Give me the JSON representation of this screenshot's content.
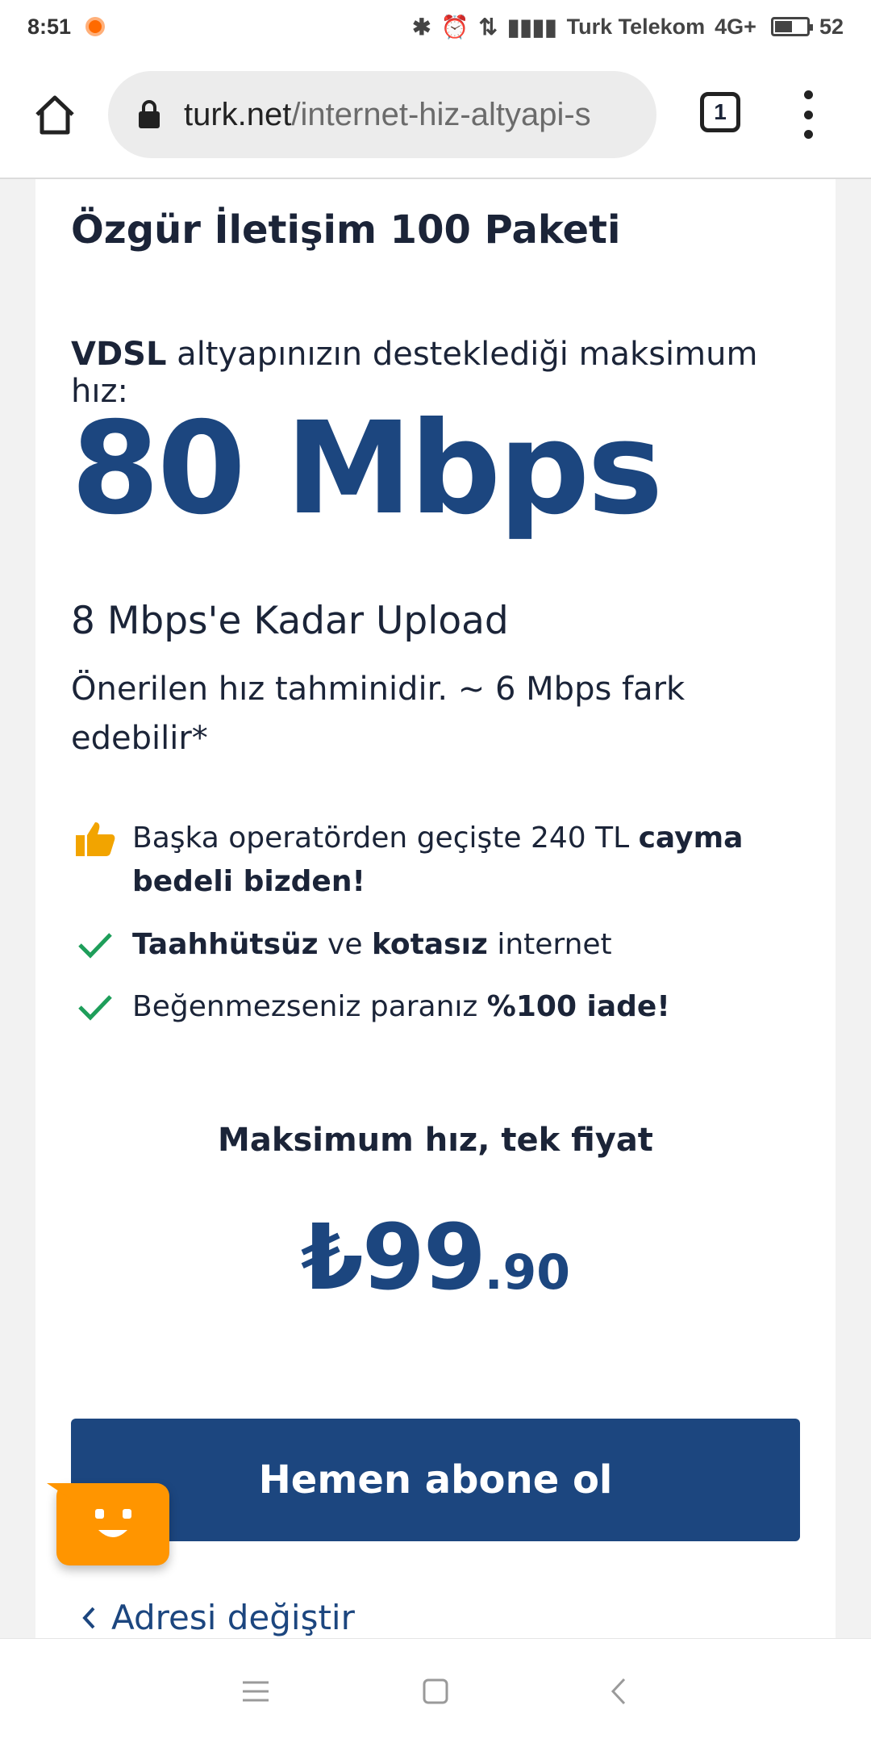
{
  "status_bar": {
    "time": "8:51",
    "carrier": "Turk Telekom",
    "network": "4G+",
    "battery": "52",
    "battery_level": 0.52,
    "icons": [
      "bluetooth-icon",
      "alarm-icon",
      "data-transfer-icon",
      "signal-icon",
      "battery-icon"
    ]
  },
  "browser": {
    "url_domain": "turk.net",
    "url_path": "/internet-hiz-altyapi-s",
    "tab_count": "1"
  },
  "package": {
    "title": "Özgür İletişim 100 Paketi",
    "infra_bold": "VDSL",
    "infra_text": " altyapınızın desteklediği maksimum hız:",
    "speed": "80 Mbps",
    "upload": "8 Mbps'e Kadar Upload",
    "note": "Önerilen hız tahminidir. ~ 6 Mbps fark edebilir*"
  },
  "features": [
    {
      "icon": "thumbs-up-icon",
      "text1": "Başka operatörden geçişte 240 TL ",
      "bold1": "cayma bedeli bizden!"
    },
    {
      "icon": "check-icon",
      "bold1": "Taahhütsüz",
      "text1": " ve ",
      "bold2": "kotasız",
      "text2": " internet"
    },
    {
      "icon": "check-icon",
      "text1": "Beğenmezseniz paranız ",
      "bold1": "%100 iade!"
    }
  ],
  "pricing": {
    "label": "Maksimum hız, tek fiyat",
    "currency": "₺",
    "amount": "99",
    "cents": ".90"
  },
  "actions": {
    "subscribe": "Hemen abone ol",
    "change_address": "Adresi değiştir"
  },
  "colors": {
    "brand_blue": "#1c467f",
    "accent_orange": "#ff9500",
    "check_green": "#1e9e5a"
  }
}
